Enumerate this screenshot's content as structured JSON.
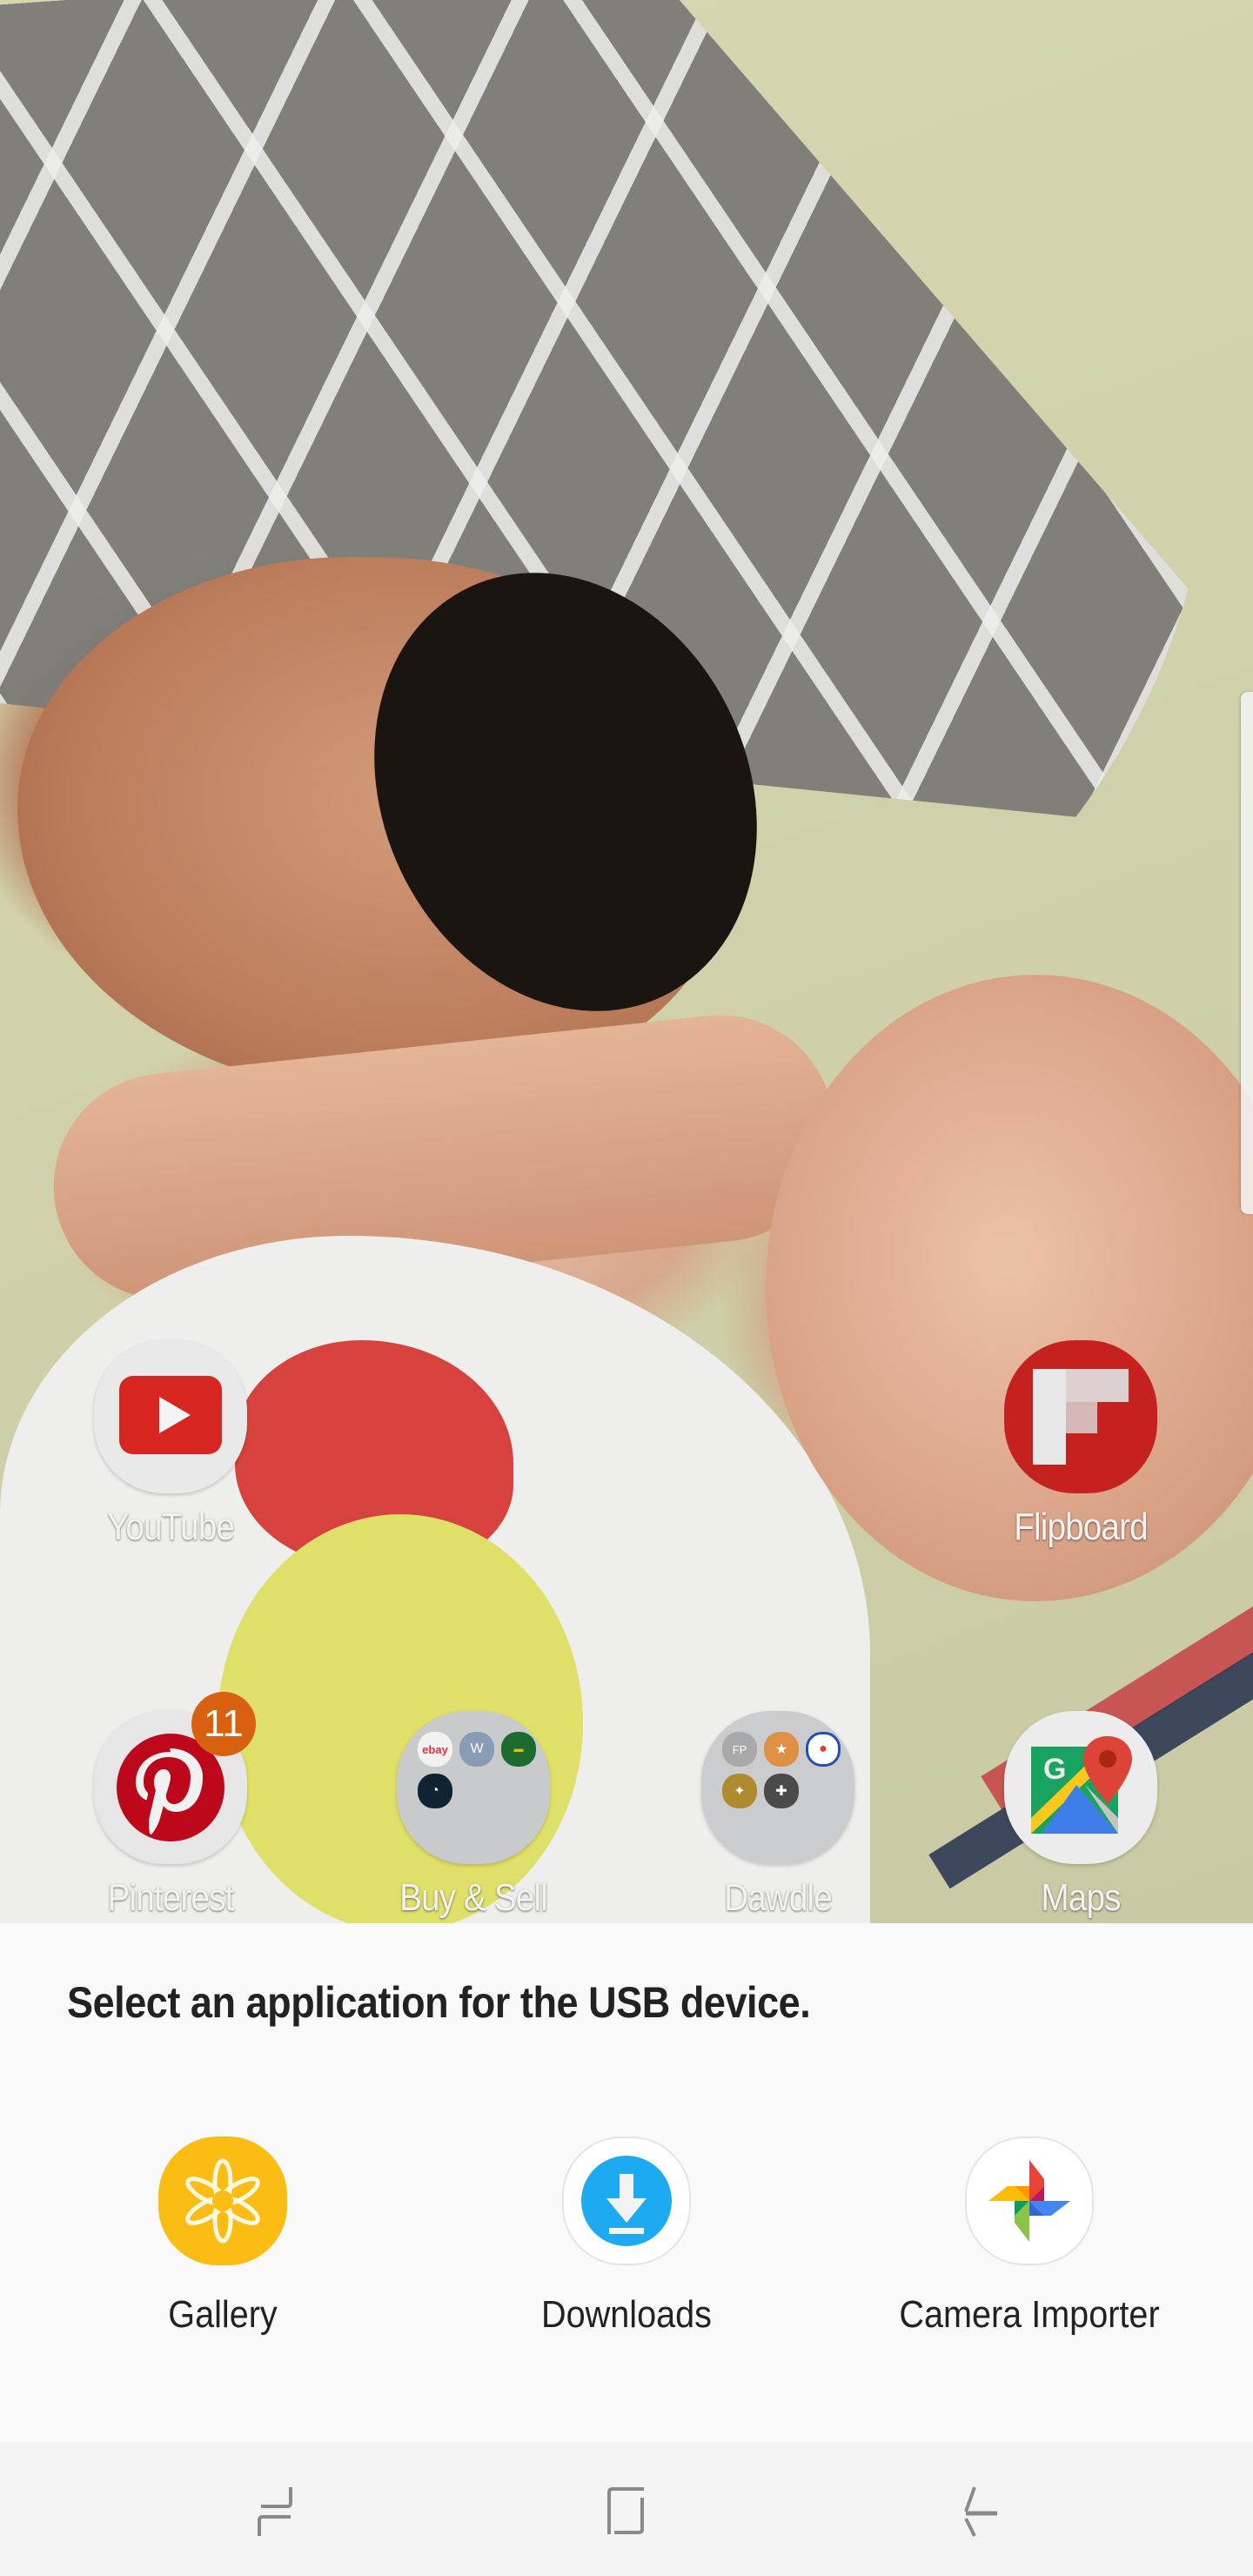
{
  "wallpaper": {
    "description": "photo of two smiling children on a grey patterned pillow"
  },
  "home_screen": {
    "row1": [
      {
        "name": "YouTube",
        "icon": "youtube-icon",
        "color": "#d7261f"
      },
      {
        "name": "Flipboard",
        "icon": "flipboard-icon",
        "color": "#c5221f"
      }
    ],
    "row2": [
      {
        "name": "Pinterest",
        "icon": "pinterest-icon",
        "color": "#bd081c",
        "badge": "11"
      },
      {
        "name": "Buy & Sell",
        "icon": "folder-icon",
        "folder_apps": [
          "ebay",
          "W",
          "deals",
          "clock"
        ]
      },
      {
        "name": "Dawdle",
        "icon": "folder-icon",
        "folder_apps": [
          "FPse",
          "fighter",
          "pokeball",
          "anime",
          "gamepad"
        ]
      },
      {
        "name": "Maps",
        "icon": "google-maps-icon"
      }
    ]
  },
  "dialog": {
    "title": "Select an application for the USB device.",
    "options": [
      {
        "label": "Gallery",
        "icon": "gallery-icon",
        "color": "#fbbd13"
      },
      {
        "label": "Downloads",
        "icon": "download-icon",
        "color": "#1eaaf1"
      },
      {
        "label": "Camera Importer",
        "icon": "google-photos-icon"
      }
    ]
  },
  "navbar": {
    "recents": "recent-apps",
    "home": "home",
    "back": "back"
  },
  "colors": {
    "sheet_bg": "#f9f9f9",
    "nav_bg": "#f4f4f4",
    "nav_icon": "#8a8a8a",
    "badge": "#d9600f"
  }
}
